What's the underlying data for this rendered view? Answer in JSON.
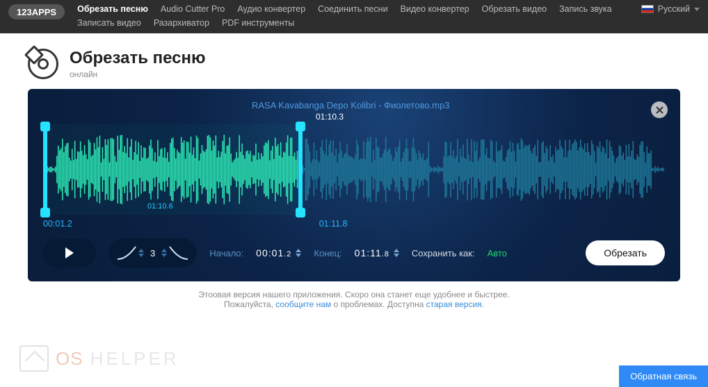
{
  "nav": {
    "logo": "123APPS",
    "items": [
      {
        "label": "Обрезать песню",
        "active": true
      },
      {
        "label": "Audio Cutter Pro"
      },
      {
        "label": "Аудио конвертер"
      },
      {
        "label": "Соединить песни"
      },
      {
        "label": "Видео конвертер"
      },
      {
        "label": "Обрезать видео"
      },
      {
        "label": "Запись звука"
      },
      {
        "label": "Записать видео"
      },
      {
        "label": "Разархиватор"
      },
      {
        "label": "PDF инструменты"
      }
    ],
    "language": "Русский"
  },
  "header": {
    "title": "Обрезать песню",
    "subtitle": "онлайн"
  },
  "editor": {
    "filename": "RASA Kavabanga Depo Kolibri - Фиолетово.mp3",
    "playhead_time": "01:10.3",
    "tick_label": "01:10.6",
    "start_label": "00:01.2",
    "end_label": "01:11.8"
  },
  "controls": {
    "fade_value": "3",
    "start_label": "Начало:",
    "start_main": "00:01",
    "start_frac": ".2",
    "end_label": "Конец:",
    "end_main": "01:11",
    "end_frac": ".8",
    "save_as_label": "Сохранить как:",
    "format": "Авто",
    "cut_button": "Обрезать"
  },
  "footer": {
    "line1_a": "Это",
    "line1_b": "овая версия нашего приложения. Скоро она станет еще удобнее и быстрее.",
    "line2_a": "Пожалуйста, ",
    "link1": "сообщите нам",
    "line2_b": " о проблемах. Доступна ",
    "link2": "старая версия",
    "line2_c": ".",
    "feedback": "Обратная связь"
  },
  "watermark": {
    "t1": "OS",
    "t2": "HELPER"
  }
}
